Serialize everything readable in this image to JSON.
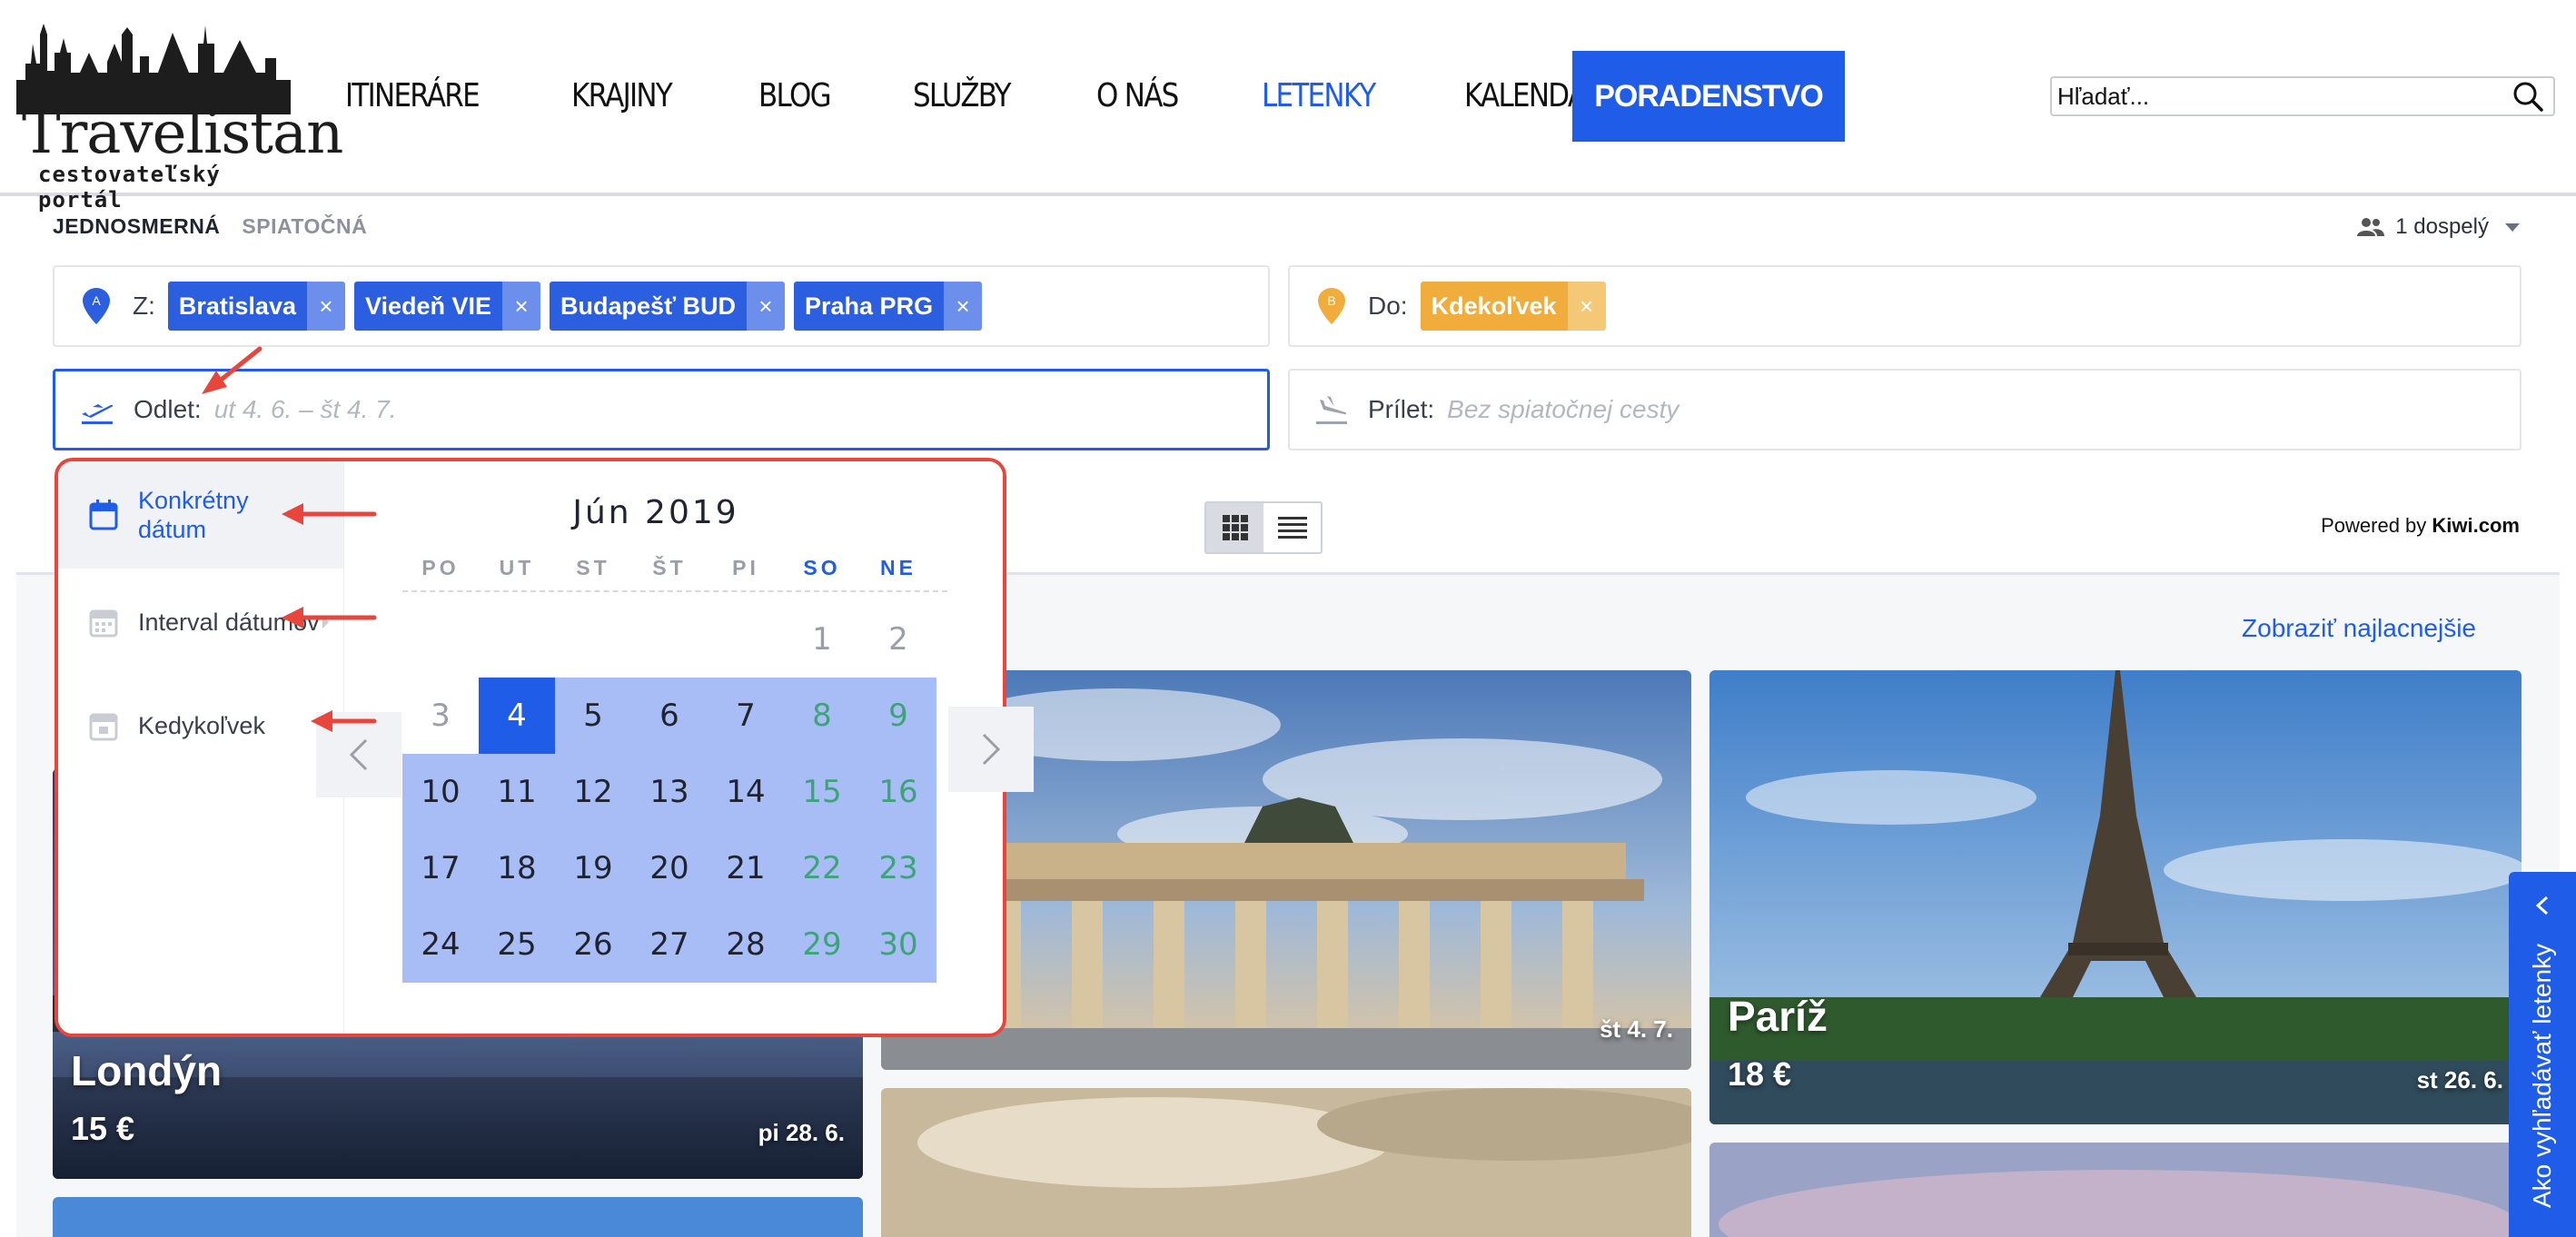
{
  "header": {
    "logo_text": "Travelistan",
    "logo_sub": "cestovateľský portál",
    "nav": [
      {
        "label": "ITINERÁRE",
        "active": false
      },
      {
        "label": "KRAJINY",
        "active": false
      },
      {
        "label": "BLOG",
        "active": false
      },
      {
        "label": "SLUŽBY",
        "active": false
      },
      {
        "label": "O NÁS",
        "active": false
      },
      {
        "label": "LETENKY",
        "active": true
      },
      {
        "label": "KALENDÁR",
        "active": false
      }
    ],
    "cta_label": "PORADENSTVO",
    "search_placeholder": "Hľadať..."
  },
  "form": {
    "trip_types": [
      "JEDNOSMERNÁ",
      "SPIATOČNÁ"
    ],
    "passengers": "1 dospelý",
    "from_label": "Z:",
    "from_chips": [
      "Bratislava",
      "Viedeň VIE",
      "Budapešť BUD",
      "Praha PRG"
    ],
    "to_label": "Do:",
    "to_chips": [
      "Kdekoľvek"
    ],
    "chip_remove": "×",
    "depart_label": "Odlet:",
    "depart_placeholder": "ut 4. 6. – št 4. 7.",
    "return_label": "Prílet:",
    "return_placeholder": "Bez spiatočnej cesty",
    "pin_from_letter": "A",
    "pin_to_letter": "B"
  },
  "datepicker": {
    "modes": [
      {
        "label": "Konkrétny dátum",
        "active": true
      },
      {
        "label": "Interval dátumov",
        "active": false
      },
      {
        "label": "Kedykoľvek",
        "active": false
      }
    ],
    "month_title": "Jún 2019",
    "weekdays": [
      "PO",
      "UT",
      "ST",
      "ŠT",
      "PI",
      "SO",
      "NE"
    ],
    "weekend_index": [
      5,
      6
    ],
    "first_weekday_index": 5,
    "days_in_month": 30,
    "past_days": [
      1,
      2,
      3
    ],
    "selected_day": 4,
    "range_start": 4,
    "range_end": 30
  },
  "results": {
    "powered_prefix": "Powered by",
    "powered_brand": "Kiwi.com",
    "cheapest_link": "Zobraziť najlacnejšie",
    "cards": [
      {
        "city": "Londýn",
        "price": "15 €",
        "date": "pi 28. 6."
      },
      {
        "city": "",
        "price": "",
        "date": "št 4. 7."
      },
      {
        "city": "Paríž",
        "price": "18 €",
        "date": "st 26. 6."
      }
    ]
  },
  "side_tab": "Ako vyhľadávať letenky",
  "colors": {
    "accent": "#1f5ce8",
    "range": "#a8bdf6",
    "weekend": "#3fa37a",
    "chip_orange": "#f1ad3b",
    "annotation": "#e8453c"
  }
}
